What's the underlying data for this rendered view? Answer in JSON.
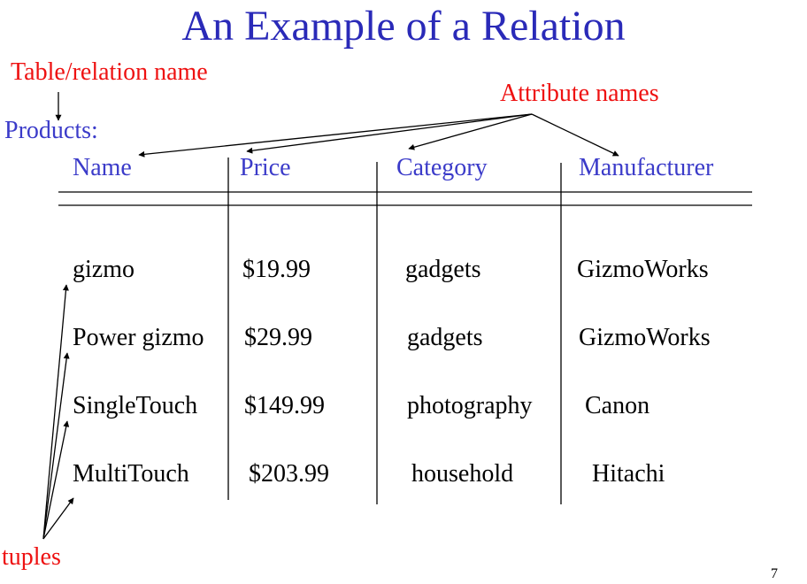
{
  "title": "An Example of a Relation",
  "annotations": {
    "table_relation_name": "Table/relation name",
    "attribute_names": "Attribute names",
    "tuples": "tuples"
  },
  "relation_name": "Products:",
  "columns": [
    "Name",
    "Price",
    "Category",
    "Manufacturer"
  ],
  "rows": [
    [
      "gizmo",
      "$19.99",
      "gadgets",
      "GizmoWorks"
    ],
    [
      "Power gizmo",
      "$29.99",
      "gadgets",
      "GizmoWorks"
    ],
    [
      "SingleTouch",
      "$149.99",
      "photography",
      "Canon"
    ],
    [
      "MultiTouch",
      "$203.99",
      "household",
      "Hitachi"
    ]
  ],
  "page_number": "7",
  "colors": {
    "title_blue": "#2a2ab8",
    "header_blue": "#3b3bc9",
    "annotation_red": "#ee1111",
    "lines": "#000000"
  }
}
